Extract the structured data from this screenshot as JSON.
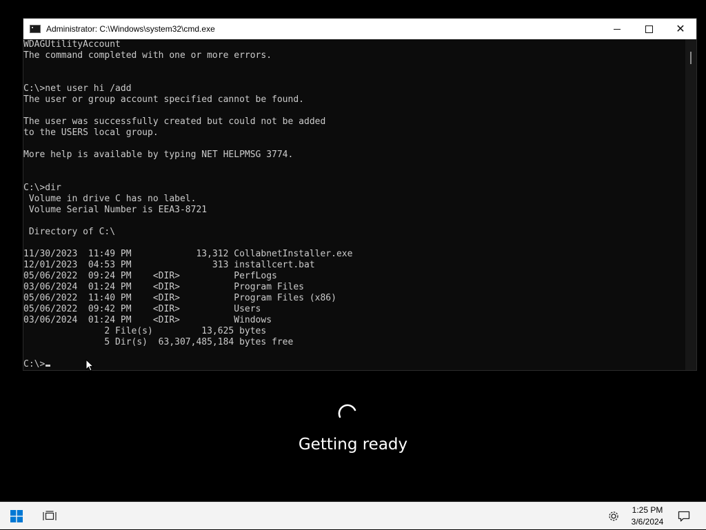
{
  "window": {
    "title": "Administrator: C:\\Windows\\system32\\cmd.exe",
    "icon": "cmd-icon",
    "controls": [
      "minimize-icon",
      "maximize-icon",
      "close-icon"
    ],
    "close_glyph": "✕"
  },
  "console": {
    "lines": [
      "WDAGUtilityAccount",
      "The command completed with one or more errors.",
      "",
      "",
      "C:\\>net user hi /add",
      "The user or group account specified cannot be found.",
      "",
      "The user was successfully created but could not be added",
      "to the USERS local group.",
      "",
      "More help is available by typing NET HELPMSG 3774.",
      "",
      "",
      "C:\\>dir",
      " Volume in drive C has no label.",
      " Volume Serial Number is EEA3-8721",
      "",
      " Directory of C:\\",
      "",
      "11/30/2023  11:49 PM            13,312 CollabnetInstaller.exe",
      "12/01/2023  04:53 PM               313 installcert.bat",
      "05/06/2022  09:24 PM    <DIR>          PerfLogs",
      "03/06/2024  01:24 PM    <DIR>          Program Files",
      "05/06/2022  11:40 PM    <DIR>          Program Files (x86)",
      "05/06/2022  09:42 PM    <DIR>          Users",
      "03/06/2024  01:24 PM    <DIR>          Windows",
      "               2 File(s)         13,625 bytes",
      "               5 Dir(s)  63,307,485,184 bytes free",
      ""
    ],
    "prompt": "C:\\>",
    "text_color": "#cccccc",
    "background": "#0c0c0c"
  },
  "overlay": {
    "status_text": "Getting ready",
    "spinner_icon": "spinner-icon"
  },
  "taskbar": {
    "start_icon": "windows-start-icon",
    "taskview_icon": "task-view-icon",
    "settings_icon": "gear-icon",
    "notification_icon": "notification-icon",
    "clock": {
      "time": "1:25 PM",
      "date": "3/6/2024"
    }
  }
}
